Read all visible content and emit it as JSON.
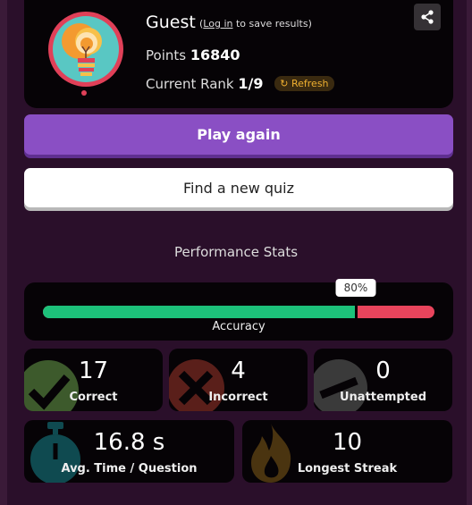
{
  "profile": {
    "name": "Guest",
    "login_link": "Log in",
    "login_suffix": " to save results)",
    "points_label": "Points",
    "points_value": "16840",
    "rank_label": "Current Rank",
    "rank_value": "1/9",
    "refresh_label": "Refresh",
    "share_icon": "share-icon",
    "avatar_icon": "lightbulb-icon"
  },
  "actions": {
    "play_again": "Play again",
    "find_quiz": "Find a new quiz"
  },
  "stats": {
    "heading": "Performance Stats",
    "accuracy": {
      "label": "Accuracy",
      "percent_text": "80%",
      "value": 0.8
    },
    "tiles": [
      {
        "value": "17",
        "label": "Correct",
        "icon": "checkmark-icon",
        "color": "#3d5a2c"
      },
      {
        "value": "4",
        "label": "Incorrect",
        "icon": "x-mark-icon",
        "color": "#5a1f1a"
      },
      {
        "value": "0",
        "label": "Unattempted",
        "icon": "minus-icon",
        "color": "#3a3a3a"
      },
      {
        "value": "16.8 s",
        "label": "Avg. Time / Question",
        "icon": "stopwatch-icon",
        "color": "#0f4a50"
      },
      {
        "value": "10",
        "label": "Longest Streak",
        "icon": "flame-icon",
        "color": "#4a3410"
      }
    ]
  },
  "colors": {
    "background": "#2a0f2a",
    "card": "#060306",
    "play_button": "#8a4fc4",
    "accuracy_correct": "#1dc17a",
    "accuracy_incorrect": "#e8445c",
    "refresh": "#f0b030"
  }
}
